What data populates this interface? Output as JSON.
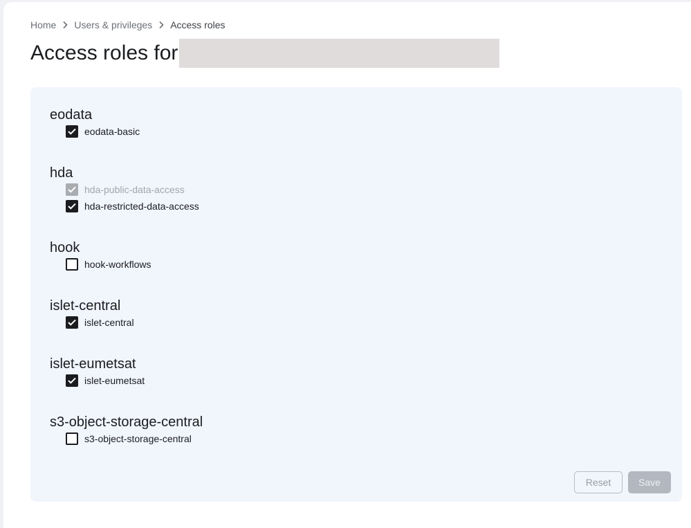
{
  "breadcrumb": {
    "items": [
      "Home",
      "Users & privileges",
      "Access roles"
    ]
  },
  "page": {
    "title": "Access roles for"
  },
  "groups": [
    {
      "name": "eodata",
      "roles": [
        {
          "label": "eodata-basic",
          "checked": true,
          "disabled": false
        }
      ]
    },
    {
      "name": "hda",
      "roles": [
        {
          "label": "hda-public-data-access",
          "checked": true,
          "disabled": true
        },
        {
          "label": "hda-restricted-data-access",
          "checked": true,
          "disabled": false
        }
      ]
    },
    {
      "name": "hook",
      "roles": [
        {
          "label": "hook-workflows",
          "checked": false,
          "disabled": false
        }
      ]
    },
    {
      "name": "islet-central",
      "roles": [
        {
          "label": "islet-central",
          "checked": true,
          "disabled": false
        }
      ]
    },
    {
      "name": "islet-eumetsat",
      "roles": [
        {
          "label": "islet-eumetsat",
          "checked": true,
          "disabled": false
        }
      ]
    },
    {
      "name": "s3-object-storage-central",
      "roles": [
        {
          "label": "s3-object-storage-central",
          "checked": false,
          "disabled": false
        }
      ]
    }
  ],
  "actions": {
    "reset_label": "Reset",
    "save_label": "Save"
  },
  "colors": {
    "page_bg": "#ffffff",
    "panel_bg": "#f1f5fc",
    "checkbox_checked": "#1a1c1f",
    "checkbox_disabled": "#a9acb1",
    "save_disabled_bg": "#b3b7bf"
  }
}
